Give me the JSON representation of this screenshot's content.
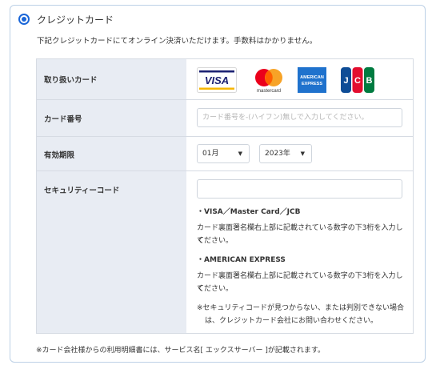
{
  "payment_method": {
    "label": "クレジットカード",
    "selected": true
  },
  "description": "下記クレジットカードにてオンライン決済いただけます。手数料はかかりません。",
  "rows": {
    "cards": {
      "label": "取り扱いカード",
      "logos": [
        "VISA",
        "mastercard",
        "AMERICAN EXPRESS",
        "JCB"
      ]
    },
    "card_number": {
      "label": "カード番号",
      "placeholder": "カード番号を-(ハイフン)無しで入力してください。"
    },
    "expiry": {
      "label": "有効期限",
      "month": "01月",
      "year": "2023年"
    },
    "security": {
      "label": "セキュリティーコード",
      "visa_heading": "・VISA／Master Card／JCB",
      "visa_text_line1": "カード裏面署名欄右上部に記載されている数字の下3桁を入力して",
      "visa_text_line2": "ください。",
      "amex_heading": "・AMERICAN EXPRESS",
      "amex_text_line1": "カード裏面署名欄右上部に記載されている数字の下3桁を入力して",
      "amex_text_line2": "ください。",
      "note_line1": "※セキュリティコードが見つからない、または判別できない場合",
      "note_line2": "は、クレジットカード会社にお問い合わせください。"
    }
  },
  "footnote": "※カード会社様からの利用明細書には、サービス名[ エックスサーバー ]が記載されます。",
  "colors": {
    "accent": "#1a66d8",
    "header_bg": "#e8ecf3",
    "border": "#d6dbe3"
  }
}
